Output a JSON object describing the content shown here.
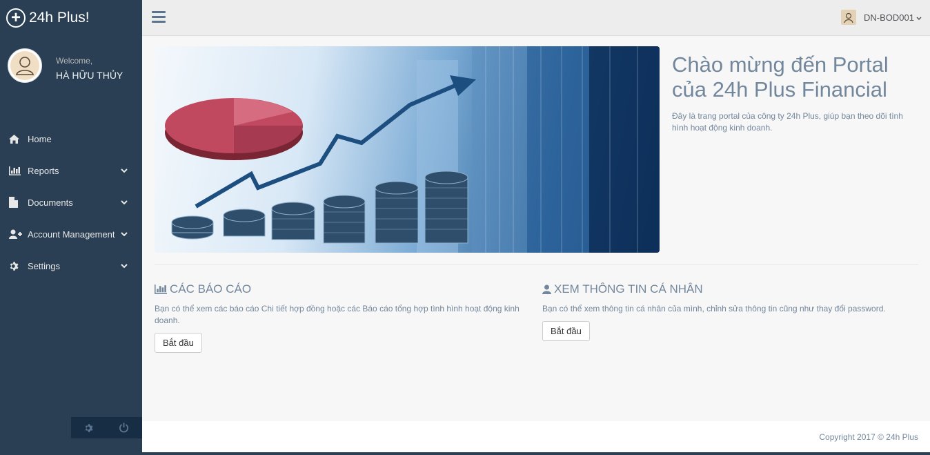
{
  "brand": {
    "name": "24h Plus!"
  },
  "profile": {
    "welcome": "Welcome,",
    "name": "HÀ HỮU THỦY"
  },
  "menu": [
    {
      "label": "Home",
      "icon": "home-icon",
      "has_submenu": false
    },
    {
      "label": "Reports",
      "icon": "bar-chart-icon",
      "has_submenu": true
    },
    {
      "label": "Documents",
      "icon": "file-icon",
      "has_submenu": true
    },
    {
      "label": "Account Management",
      "icon": "user-add-icon",
      "has_submenu": true
    },
    {
      "label": "Settings",
      "icon": "gear-icon",
      "has_submenu": true
    }
  ],
  "topnav": {
    "username": "DN-BOD001"
  },
  "intro": {
    "title": "Chào mừng đến Portal của 24h Plus Financial",
    "description": "Đây là trang portal của công ty 24h Plus, giúp bạn theo dõi tình hình hoạt động kinh doanh."
  },
  "sections": [
    {
      "title": "CÁC BÁO CÁO",
      "icon": "bar-chart-icon",
      "description": "Bạn có thể xem các báo cáo Chi tiết hợp đồng hoặc các Báo cáo tổng hợp tình hình hoạt động kinh doanh.",
      "button": "Bắt đầu"
    },
    {
      "title": "XEM THÔNG TIN CÁ NHÂN",
      "icon": "user-icon",
      "description": "Bạn có thể xem thông tin cá nhân của mình, chỉnh sửa thông tin cũng như thay đổi password.",
      "button": "Bắt đầu"
    }
  ],
  "footer": {
    "copyright": "Copyright 2017 © 24h Plus"
  },
  "colors": {
    "sidebar": "#2a3f54",
    "text_muted": "#73879c",
    "background": "#f7f7f7"
  }
}
